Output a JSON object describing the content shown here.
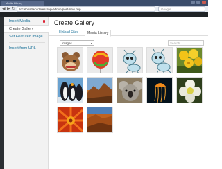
{
  "browser": {
    "tab_title": "Media Library",
    "url": "localhost/wordpress/wp-admin/post-new.php",
    "search_placeholder": "Google"
  },
  "sidebar": {
    "items": [
      {
        "label": "Insert Media"
      },
      {
        "label": "Create Gallery"
      },
      {
        "label": "Set Featured Image"
      },
      {
        "label": "Insert from URL"
      }
    ]
  },
  "main": {
    "title": "Create Gallery",
    "tabs": [
      {
        "label": "Upload Files"
      },
      {
        "label": "Media Library"
      }
    ],
    "filter": {
      "selected": "Images"
    },
    "search": {
      "placeholder": "Search"
    }
  },
  "media": [
    {
      "name": "bear-cartoon"
    },
    {
      "name": "balloon-cartoon"
    },
    {
      "name": "ant-cartoon"
    },
    {
      "name": "ant-cartoon-2"
    },
    {
      "name": "yellow-flowers"
    },
    {
      "name": "penguins"
    },
    {
      "name": "desert-rocks"
    },
    {
      "name": "koala"
    },
    {
      "name": "jellyfish"
    },
    {
      "name": "white-flower"
    },
    {
      "name": "red-flower"
    },
    {
      "name": "canyon"
    }
  ]
}
